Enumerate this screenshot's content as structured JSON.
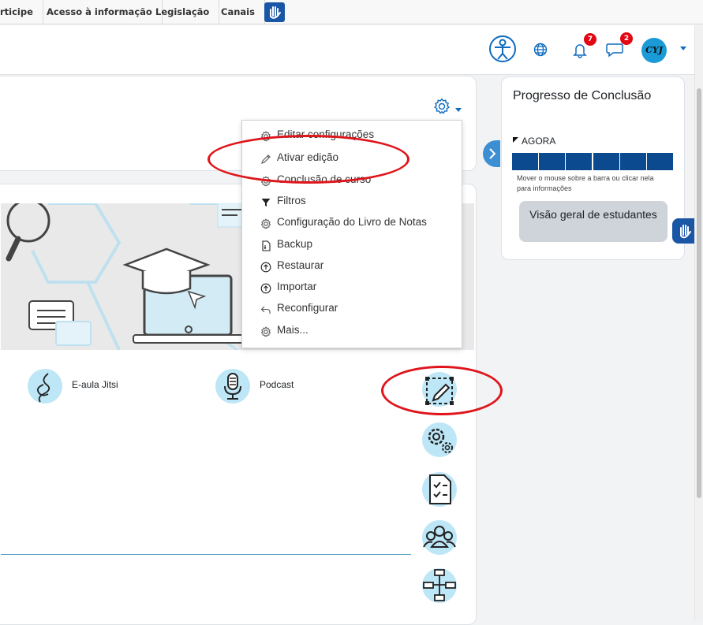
{
  "gov_bar": {
    "links": [
      "rticipe",
      "Acesso à informação",
      "Legislação",
      "Canais"
    ]
  },
  "navbar": {
    "notifications_count": "7",
    "messages_count": "2",
    "avatar_text": "CYJ"
  },
  "settings_menu": {
    "items": [
      {
        "label": "Editar configurações",
        "icon": "gear-icon"
      },
      {
        "label": "Ativar edição",
        "icon": "pencil-icon"
      },
      {
        "label": "Conclusão de curso",
        "icon": "gear-icon"
      },
      {
        "label": "Filtros",
        "icon": "filter-icon"
      },
      {
        "label": "Configuração do Livro de Notas",
        "icon": "gear-icon"
      },
      {
        "label": "Backup",
        "icon": "file-icon"
      },
      {
        "label": "Restaurar",
        "icon": "upload-icon"
      },
      {
        "label": "Importar",
        "icon": "upload-icon"
      },
      {
        "label": "Reconfigurar",
        "icon": "undo-icon"
      },
      {
        "label": "Mais...",
        "icon": "gear-icon"
      }
    ]
  },
  "activities": [
    {
      "label": "E-aula Jitsi",
      "icon": "jitsi-icon"
    },
    {
      "label": "Podcast",
      "icon": "microphone-icon"
    }
  ],
  "completion_block": {
    "title": "Progresso de Conclusão",
    "now_label": "AGORA",
    "progress_segments": 6,
    "hint": "Mover o mouse sobre a barra ou clicar nela para informações",
    "button_label": "Visão geral de estudantes"
  },
  "colors": {
    "accent": "#0f6cbf",
    "progress_blue": "#0b4a8f",
    "highlight_red": "#e0141b",
    "icon_bg": "#bde6f6"
  }
}
